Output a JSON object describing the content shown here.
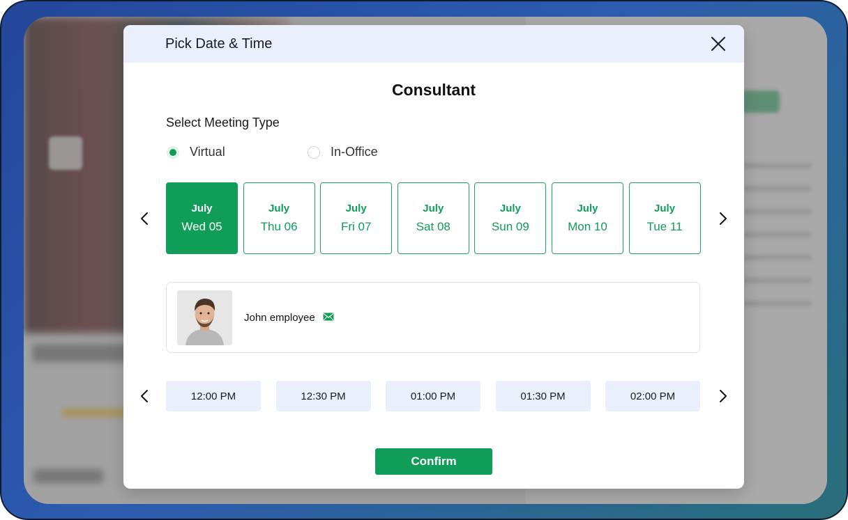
{
  "modal": {
    "title": "Pick Date & Time",
    "heading": "Consultant",
    "meeting_type_label": "Select Meeting Type",
    "meeting_types": [
      {
        "label": "Virtual",
        "checked": true
      },
      {
        "label": "In-Office",
        "checked": false
      }
    ],
    "dates": [
      {
        "month": "July",
        "day": "Wed 05",
        "selected": true
      },
      {
        "month": "July",
        "day": "Thu 06",
        "selected": false
      },
      {
        "month": "July",
        "day": "Fri 07",
        "selected": false
      },
      {
        "month": "July",
        "day": "Sat 08",
        "selected": false
      },
      {
        "month": "July",
        "day": "Sun 09",
        "selected": false
      },
      {
        "month": "July",
        "day": "Mon 10",
        "selected": false
      },
      {
        "month": "July",
        "day": "Tue 11",
        "selected": false
      }
    ],
    "employee": {
      "name": "John employee"
    },
    "time_slots": [
      "12:00 PM",
      "12:30 PM",
      "01:00 PM",
      "01:30 PM",
      "02:00 PM"
    ],
    "confirm_label": "Confirm"
  },
  "icons": {
    "close": "close-icon",
    "prev": "chevron-left-icon",
    "next": "chevron-right-icon",
    "mail": "mail-icon"
  },
  "colors": {
    "accent": "#0f9d58",
    "header_bg": "#e9f0fb",
    "slot_bg": "#e9f0fb"
  }
}
